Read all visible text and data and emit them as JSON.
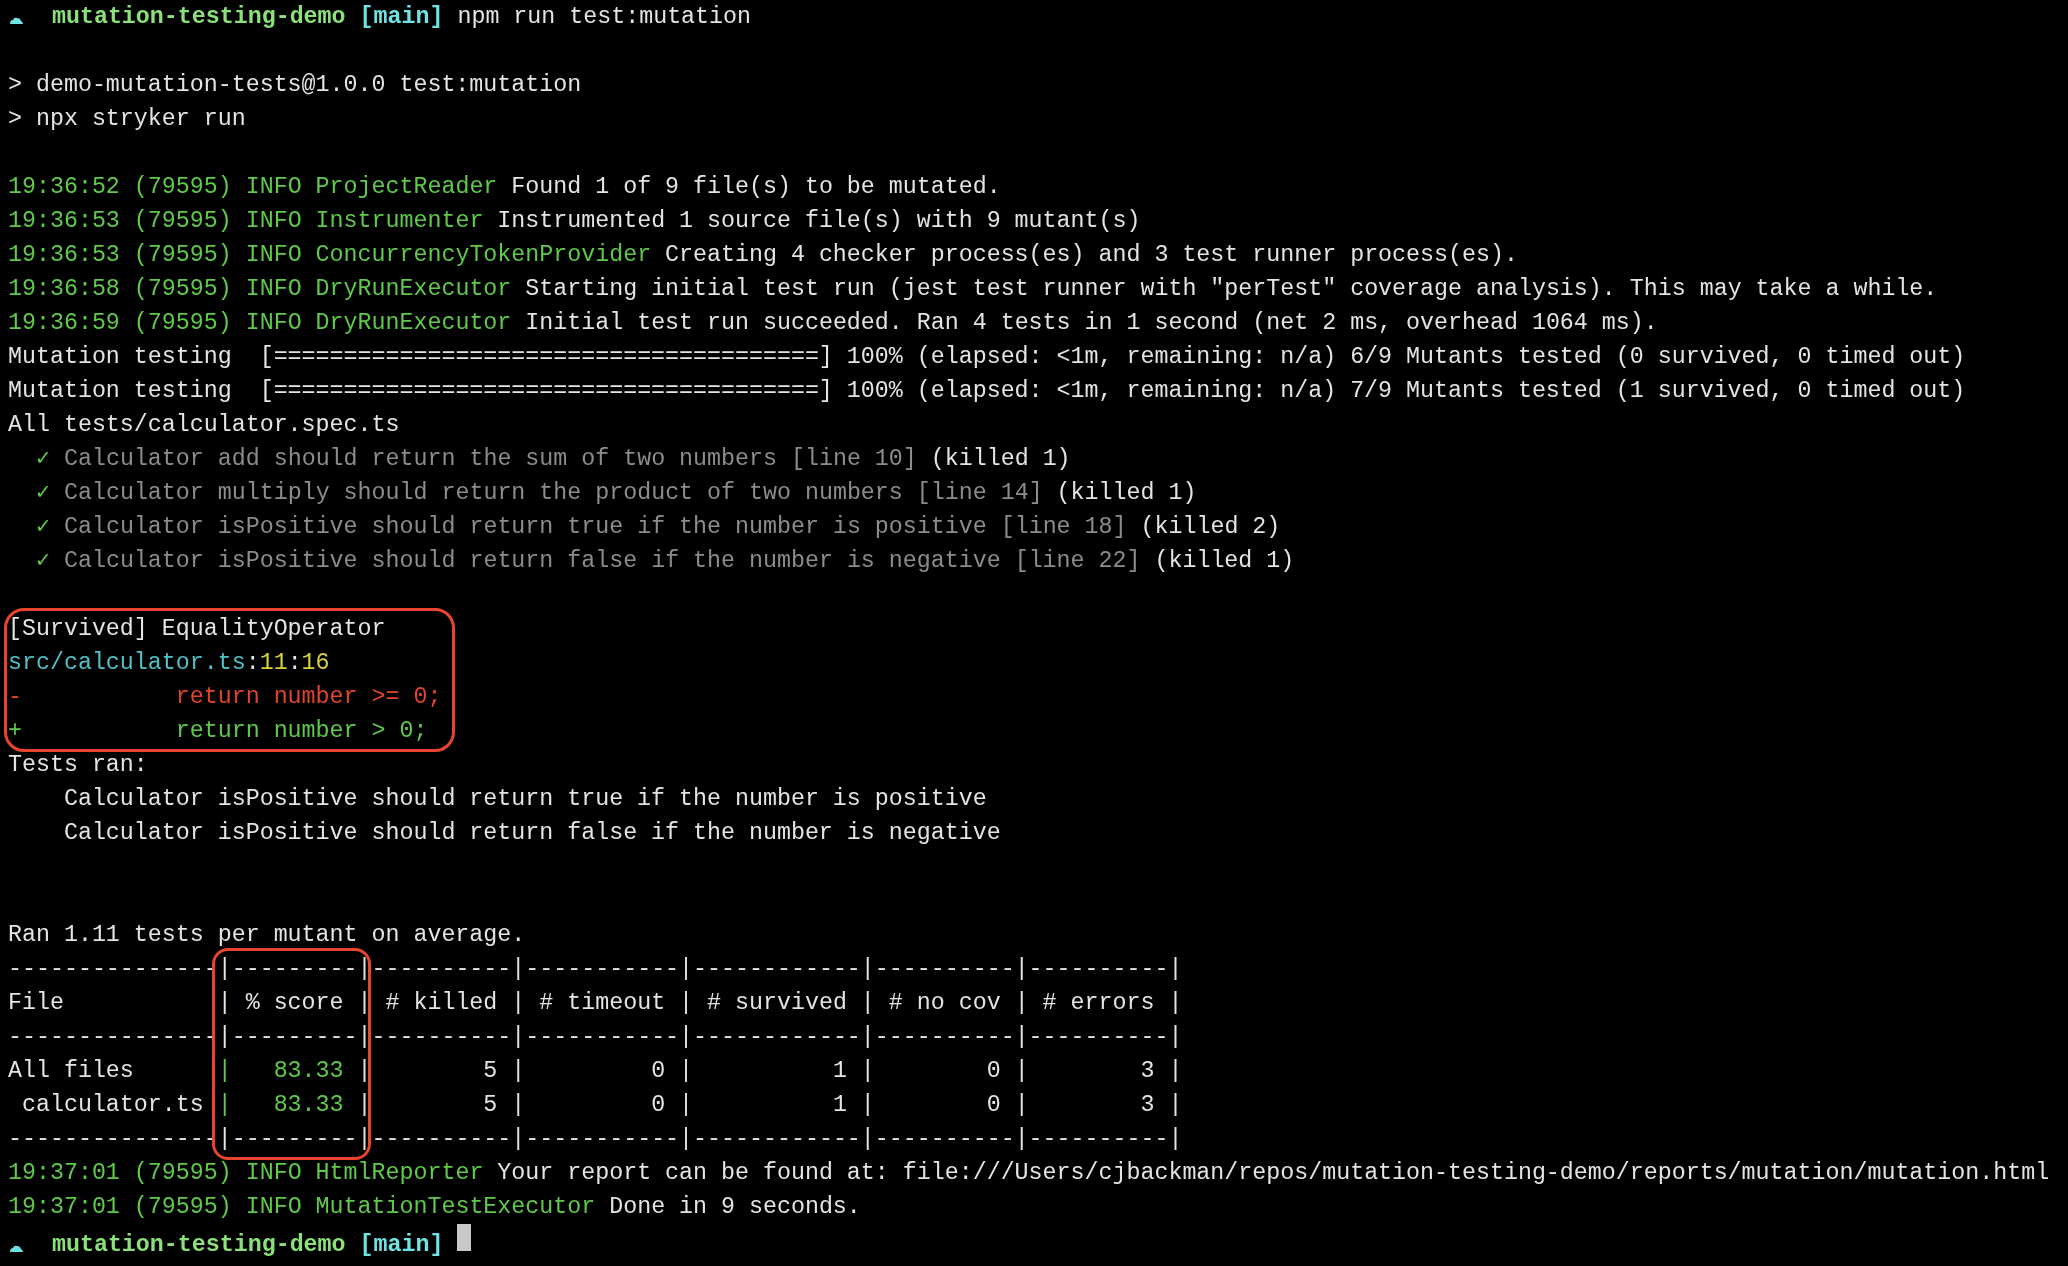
{
  "lines": [
    {
      "kind": "prompt",
      "dir": "mutation-testing-demo",
      "branch": "[main]",
      "command": "npm run test:mutation"
    },
    {
      "kind": "blank"
    },
    {
      "kind": "script",
      "text": "> demo-mutation-tests@1.0.0 test:mutation"
    },
    {
      "kind": "script",
      "text": "> npx stryker run"
    },
    {
      "kind": "blank"
    },
    {
      "kind": "log",
      "time": "19:36:52",
      "pid": "(79595)",
      "level": "INFO",
      "source": "ProjectReader",
      "message": "Found 1 of 9 file(s) to be mutated."
    },
    {
      "kind": "log",
      "time": "19:36:53",
      "pid": "(79595)",
      "level": "INFO",
      "source": "Instrumenter",
      "message": "Instrumented 1 source file(s) with 9 mutant(s)"
    },
    {
      "kind": "log",
      "time": "19:36:53",
      "pid": "(79595)",
      "level": "INFO",
      "source": "ConcurrencyTokenProvider",
      "message": "Creating 4 checker process(es) and 3 test runner process(es)."
    },
    {
      "kind": "log",
      "time": "19:36:58",
      "pid": "(79595)",
      "level": "INFO",
      "source": "DryRunExecutor",
      "message": "Starting initial test run (jest test runner with \"perTest\" coverage analysis). This may take a while."
    },
    {
      "kind": "log",
      "time": "19:36:59",
      "pid": "(79595)",
      "level": "INFO",
      "source": "DryRunExecutor",
      "message": "Initial test run succeeded. Ran 4 tests in 1 second (net 2 ms, overhead 1064 ms)."
    },
    {
      "kind": "progress",
      "label": "Mutation testing",
      "bar": "[=======================================]",
      "summary": "100% (elapsed: <1m, remaining: n/a) 6/9 Mutants tested (0 survived, 0 timed out)"
    },
    {
      "kind": "progress",
      "label": "Mutation testing",
      "bar": "[=======================================]",
      "summary": "100% (elapsed: <1m, remaining: n/a) 7/9 Mutants tested (1 survived, 0 timed out)"
    },
    {
      "kind": "plain",
      "text": "All tests/calculator.spec.ts"
    },
    {
      "kind": "test",
      "mark": "✓",
      "name": "Calculator add should return the sum of two numbers",
      "location": "[line 10]",
      "result": "(killed 1)"
    },
    {
      "kind": "test",
      "mark": "✓",
      "name": "Calculator multiply should return the product of two numbers",
      "location": "[line 14]",
      "result": "(killed 1)"
    },
    {
      "kind": "test",
      "mark": "✓",
      "name": "Calculator isPositive should return true if the number is positive",
      "location": "[line 18]",
      "result": "(killed 2)"
    },
    {
      "kind": "test",
      "mark": "✓",
      "name": "Calculator isPositive should return false if the number is negative",
      "location": "[line 22]",
      "result": "(killed 1)"
    },
    {
      "kind": "blank"
    },
    {
      "kind": "mutant",
      "highlighted": true,
      "status": "[Survived]",
      "mutator": "EqualityOperator",
      "file": "src/calculator.ts",
      "separator": ":",
      "line": "11",
      "column": "16",
      "diff": [
        {
          "kind": "removed",
          "sign": "-",
          "code": "return number >= 0;"
        },
        {
          "kind": "added",
          "sign": "+",
          "code": "return number > 0;"
        }
      ]
    },
    {
      "kind": "plain",
      "text": "Tests ran:"
    },
    {
      "kind": "indented",
      "text": "Calculator isPositive should return true if the number is positive"
    },
    {
      "kind": "indented",
      "text": "Calculator isPositive should return false if the number is negative"
    },
    {
      "kind": "blank"
    },
    {
      "kind": "blank"
    },
    {
      "kind": "plain",
      "text": "Ran 1.11 tests per mutant on average."
    },
    {
      "kind": "table",
      "columns": [
        {
          "highlighted": false,
          "cells": [
            {
              "kind": "rule",
              "text": "---------------"
            },
            {
              "kind": "plain",
              "text": "File"
            },
            {
              "kind": "rule",
              "text": "---------------"
            },
            {
              "kind": "plain",
              "text": "All files"
            },
            {
              "kind": "plain",
              "text": " calculator.ts"
            },
            {
              "kind": "rule",
              "text": "---------------"
            }
          ]
        },
        {
          "highlighted": true,
          "cells": [
            {
              "kind": "rule",
              "text": "|---------"
            },
            {
              "kind": "plain",
              "text": "| % score "
            },
            {
              "kind": "rule",
              "text": "|---------"
            },
            {
              "kind": "score",
              "text": "|   83.33 "
            },
            {
              "kind": "score",
              "text": "|   83.33 "
            },
            {
              "kind": "rule",
              "text": "|---------"
            }
          ]
        },
        {
          "highlighted": false,
          "cells": [
            {
              "kind": "rule",
              "text": "|----------"
            },
            {
              "kind": "plain",
              "text": "| # killed "
            },
            {
              "kind": "rule",
              "text": "|----------"
            },
            {
              "kind": "plain",
              "text": "|        5 "
            },
            {
              "kind": "plain",
              "text": "|        5 "
            },
            {
              "kind": "rule",
              "text": "|----------"
            }
          ]
        },
        {
          "highlighted": false,
          "cells": [
            {
              "kind": "rule",
              "text": "|-----------"
            },
            {
              "kind": "plain",
              "text": "| # timeout "
            },
            {
              "kind": "rule",
              "text": "|-----------"
            },
            {
              "kind": "plain",
              "text": "|         0 "
            },
            {
              "kind": "plain",
              "text": "|         0 "
            },
            {
              "kind": "rule",
              "text": "|-----------"
            }
          ]
        },
        {
          "highlighted": false,
          "cells": [
            {
              "kind": "rule",
              "text": "|------------"
            },
            {
              "kind": "plain",
              "text": "| # survived "
            },
            {
              "kind": "rule",
              "text": "|------------"
            },
            {
              "kind": "plain",
              "text": "|          1 "
            },
            {
              "kind": "plain",
              "text": "|          1 "
            },
            {
              "kind": "rule",
              "text": "|------------"
            }
          ]
        },
        {
          "highlighted": false,
          "cells": [
            {
              "kind": "rule",
              "text": "|----------"
            },
            {
              "kind": "plain",
              "text": "| # no cov "
            },
            {
              "kind": "rule",
              "text": "|----------"
            },
            {
              "kind": "plain",
              "text": "|        0 "
            },
            {
              "kind": "plain",
              "text": "|        0 "
            },
            {
              "kind": "rule",
              "text": "|----------"
            }
          ]
        },
        {
          "highlighted": false,
          "cells": [
            {
              "kind": "rule",
              "text": "|----------|"
            },
            {
              "kind": "plain",
              "text": "| # errors |"
            },
            {
              "kind": "rule",
              "text": "|----------|"
            },
            {
              "kind": "plain",
              "text": "|        3 |"
            },
            {
              "kind": "plain",
              "text": "|        3 |"
            },
            {
              "kind": "rule",
              "text": "|----------|"
            }
          ]
        }
      ]
    },
    {
      "kind": "log",
      "time": "19:37:01",
      "pid": "(79595)",
      "level": "INFO",
      "source": "HtmlReporter",
      "message": "Your report can be found at: file:///Users/cjbackman/repos/mutation-testing-demo/reports/mutation/mutation.html"
    },
    {
      "kind": "log",
      "time": "19:37:01",
      "pid": "(79595)",
      "level": "INFO",
      "source": "MutationTestExecutor",
      "message": "Done in 9 seconds."
    },
    {
      "kind": "prompt",
      "dir": "mutation-testing-demo",
      "branch": "[main]",
      "cursor": true
    }
  ]
}
